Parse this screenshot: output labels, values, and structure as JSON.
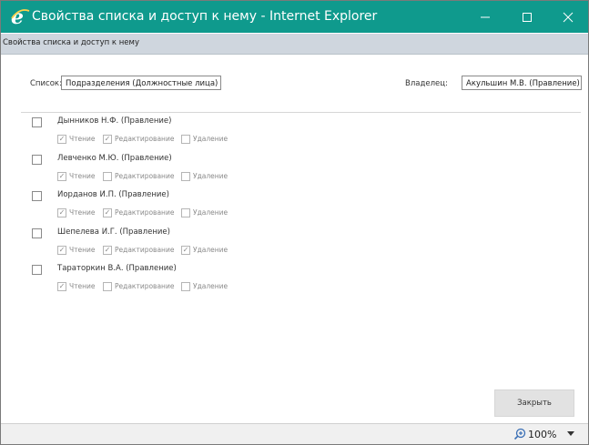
{
  "window": {
    "title": "Свойства списка и доступ к нему - Internet Explorer",
    "icon": "ie-icon",
    "controls": {
      "minimize": "minimize-icon",
      "maximize": "maximize-icon",
      "close": "close-icon"
    },
    "title_bar_color": "#0f9a8d"
  },
  "page": {
    "subtitle": "Свойства списка и доступ к нему"
  },
  "list_field": {
    "label": "Список:",
    "value": "Подразделения (Должностные лица)"
  },
  "owner_field": {
    "label": "Владелец:",
    "value": "Акульшин М.В. (Правление)"
  },
  "permission_labels": {
    "read": "Чтение",
    "edit": "Редактирование",
    "delete": "Удаление"
  },
  "people": [
    {
      "name": "Дынников Н.Ф. (Правление)",
      "selected": false,
      "read": true,
      "edit": true,
      "delete": false
    },
    {
      "name": "Левченко М.Ю. (Правление)",
      "selected": false,
      "read": true,
      "edit": false,
      "delete": false
    },
    {
      "name": "Иорданов И.П. (Правление)",
      "selected": false,
      "read": true,
      "edit": true,
      "delete": false
    },
    {
      "name": "Шепелева И.Г. (Правление)",
      "selected": false,
      "read": true,
      "edit": true,
      "delete": true
    },
    {
      "name": "Тараторкин В.А. (Правление)",
      "selected": false,
      "read": true,
      "edit": false,
      "delete": false
    }
  ],
  "close_button": {
    "label": "Закрыть"
  },
  "statusbar": {
    "zoom": "100%",
    "zoom_icon": "zoom-icon"
  }
}
